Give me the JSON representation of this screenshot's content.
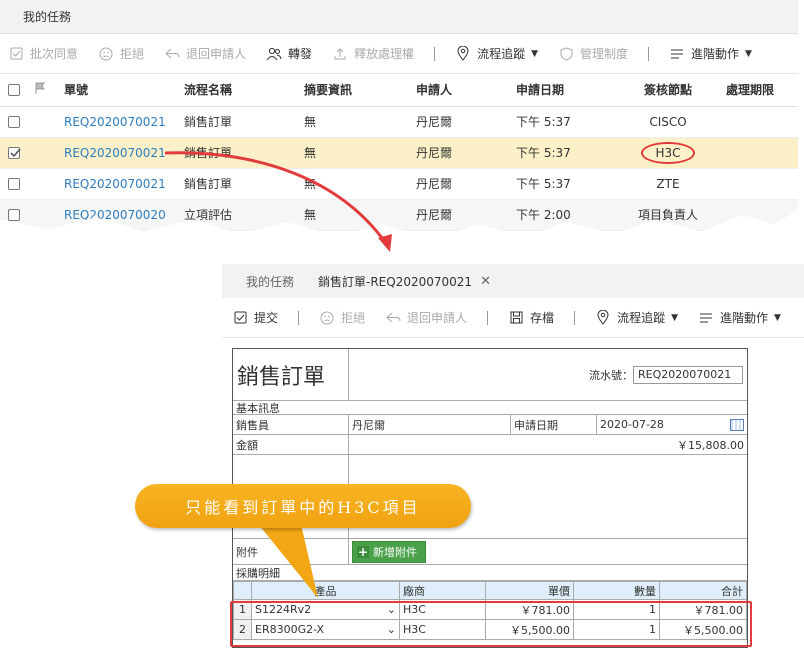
{
  "top": {
    "tab_title": "我的任務",
    "toolbar": [
      {
        "label": "批次同意",
        "icon": "checkbox-icon",
        "disabled": true
      },
      {
        "label": "拒絕",
        "icon": "sad-face-icon",
        "disabled": true
      },
      {
        "label": "退回申請人",
        "icon": "return-icon",
        "disabled": true
      },
      {
        "label": "轉發",
        "icon": "users-icon",
        "disabled": false
      },
      {
        "label": "釋放處理權",
        "icon": "upload-icon",
        "disabled": true
      },
      {
        "label": "流程追蹤",
        "icon": "location-pin-icon",
        "disabled": false
      },
      {
        "label": "管理制度",
        "icon": "shield-icon",
        "disabled": true
      },
      {
        "label": "進階動作",
        "icon": "menu-lines-icon",
        "disabled": false
      }
    ],
    "columns": [
      "單號",
      "流程名稱",
      "摘要資訊",
      "申請人",
      "申請日期",
      "簽核節點",
      "處理期限"
    ],
    "rows": [
      {
        "no": "REQ2020070021",
        "flow": "銷售訂單",
        "summary": "無",
        "applicant": "丹尼爾",
        "date": "下午 5:37",
        "node": "CISCO",
        "checked": false
      },
      {
        "no": "REQ2020070021",
        "flow": "銷售訂單",
        "summary": "無",
        "applicant": "丹尼爾",
        "date": "下午 5:37",
        "node": "H3C",
        "checked": true
      },
      {
        "no": "REQ2020070021",
        "flow": "銷售訂單",
        "summary": "無",
        "applicant": "丹尼爾",
        "date": "下午 5:37",
        "node": "ZTE",
        "checked": false
      },
      {
        "no": "REQ2020070020",
        "flow": "立項評估",
        "summary": "無",
        "applicant": "丹尼爾",
        "date": "下午 2:00",
        "node": "項目負責人",
        "checked": false
      }
    ]
  },
  "bottom": {
    "tab_home": "我的任務",
    "tab_active": "銷售訂單-REQ2020070021",
    "close_symbol": "✕",
    "toolbar": [
      {
        "label": "提交",
        "icon": "checkbox-icon",
        "disabled": false
      },
      {
        "label": "拒絕",
        "icon": "sad-face-icon",
        "disabled": true
      },
      {
        "label": "退回申請人",
        "icon": "return-icon",
        "disabled": true
      },
      {
        "label": "存檔",
        "icon": "save-icon",
        "disabled": false
      },
      {
        "label": "流程追蹤",
        "icon": "location-pin-icon",
        "disabled": false
      },
      {
        "label": "進階動作",
        "icon": "menu-lines-icon",
        "disabled": false
      }
    ],
    "form": {
      "title": "銷售訂單",
      "serial_label": "流水號：",
      "serial_value": "REQ2020070021",
      "basic_info": "基本訊息",
      "sales_label": "銷售員",
      "sales_value": "丹尼爾",
      "date_label": "申請日期",
      "date_value": "2020-07-28",
      "amount_label": "金額",
      "amount_value": "￥15,808.00",
      "attach_label": "附件",
      "attach_button": "新增附件",
      "purchase_label": "採購明細",
      "item_columns": [
        "產品",
        "廠商",
        "單價",
        "數量",
        "合計"
      ],
      "items": [
        {
          "n": "1",
          "product": "S1224Rv2",
          "vendor": "H3C",
          "price": "￥781.00",
          "qty": "1",
          "total": "￥781.00"
        },
        {
          "n": "2",
          "product": "ER8300G2-X",
          "vendor": "H3C",
          "price": "￥5,500.00",
          "qty": "1",
          "total": "￥5,500.00"
        }
      ]
    }
  },
  "callout": "只能看到訂單中的H3C項目",
  "colors": {
    "accent_red": "#e23b3b",
    "callout_orange": "#f5a81a",
    "link_blue": "#2f7ec0",
    "selected_row": "#fbf0c8"
  }
}
